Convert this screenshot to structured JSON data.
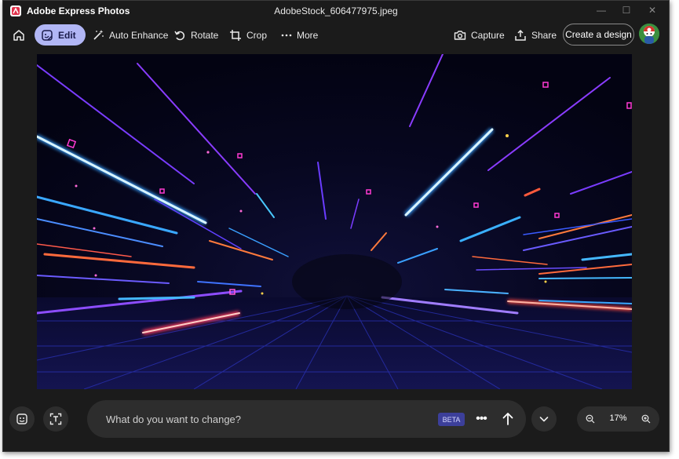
{
  "window": {
    "app_name": "Adobe Express Photos",
    "file_name": "AdobeStock_606477975.jpeg",
    "controls": {
      "minimize": "—",
      "maximize": "☐",
      "close": "✕"
    }
  },
  "toolbar": {
    "items": [
      {
        "label": "Edit",
        "icon": "sticker-edit-icon",
        "active": true
      },
      {
        "label": "Auto Enhance",
        "icon": "magic-wand-icon"
      },
      {
        "label": "Rotate",
        "icon": "rotate-icon"
      },
      {
        "label": "Crop",
        "icon": "crop-icon"
      },
      {
        "label": "More",
        "icon": "more-dots-icon"
      }
    ],
    "capture_label": "Capture",
    "share_label": "Share",
    "create_label": "Create a design",
    "home_icon": "home-icon"
  },
  "prompt": {
    "placeholder": "What do you want to change?",
    "badge": "BETA",
    "more": "•••"
  },
  "zoom": {
    "value": "17%"
  },
  "colors": {
    "accent": "#b1b6f5",
    "background": "#1b1b1b",
    "panel": "#2d2d2d"
  }
}
